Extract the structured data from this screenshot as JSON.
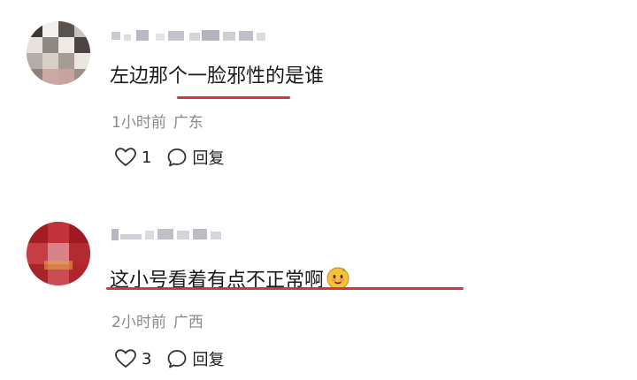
{
  "comments": [
    {
      "text": "左边那个一脸邪性的是谁",
      "time": "1小时前",
      "location": "广东",
      "likes": "1",
      "reply_label": "回复"
    },
    {
      "text": "这小号看着有点不正常啊",
      "emoji": "slightly-smiling-emoji",
      "time": "2小时前",
      "location": "广西",
      "likes": "3",
      "reply_label": "回复"
    }
  ],
  "colors": {
    "highlight_underline": "#e0303a",
    "meta_text": "#8a8a8a"
  }
}
